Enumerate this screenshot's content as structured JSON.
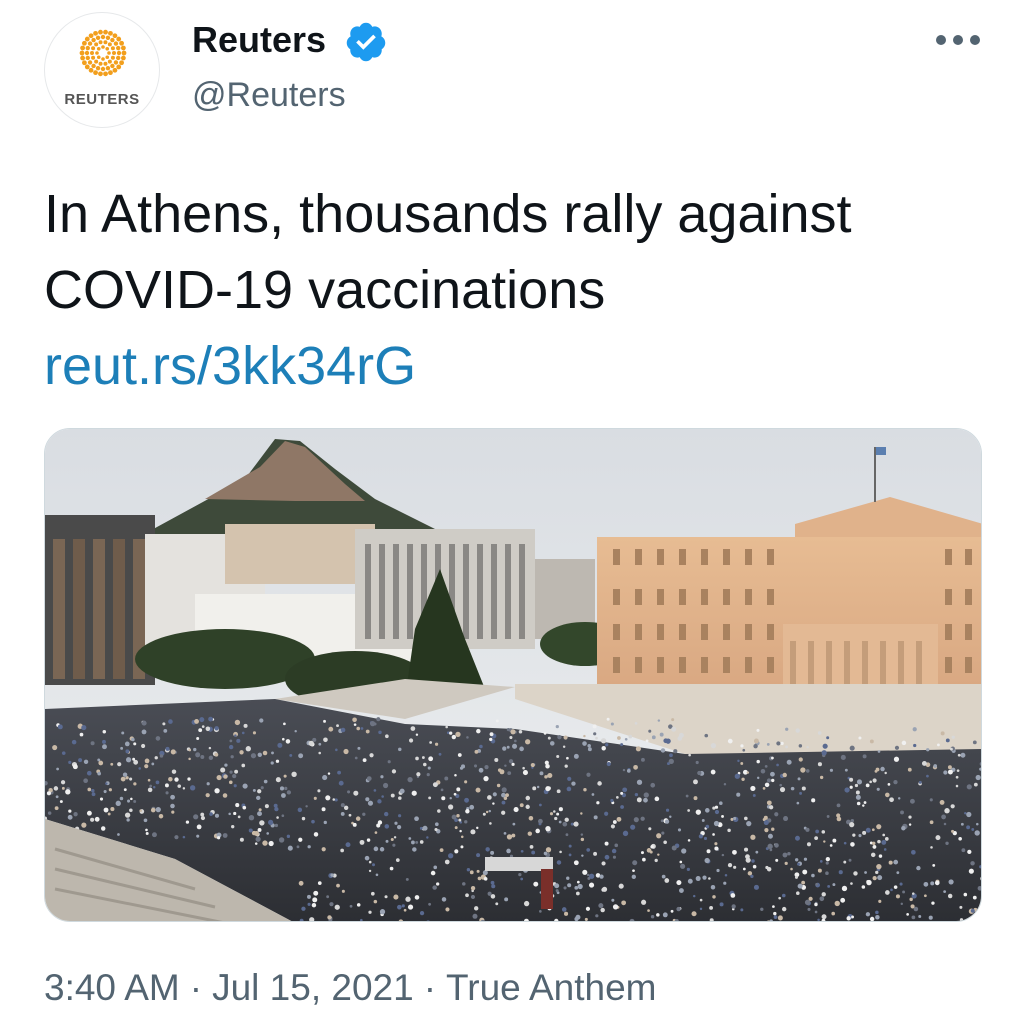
{
  "account": {
    "display_name": "Reuters",
    "handle": "@Reuters",
    "avatar_wordmark": "REUTERS",
    "verified": true
  },
  "tweet": {
    "text": "In Athens, thousands rally against COVID-19 vaccinations",
    "link": "reut.rs/3kk34rG"
  },
  "media": {
    "description_icon": "photo-crowd-athens-parliament"
  },
  "meta": {
    "time": "3:40 AM",
    "separator": "·",
    "date": "Jul 15, 2021",
    "source": "True Anthem"
  },
  "colors": {
    "link": "#1d7fb8",
    "verified": "#1d9bf0",
    "secondary_text": "#536471",
    "avatar_brand": "#f29f1d"
  }
}
